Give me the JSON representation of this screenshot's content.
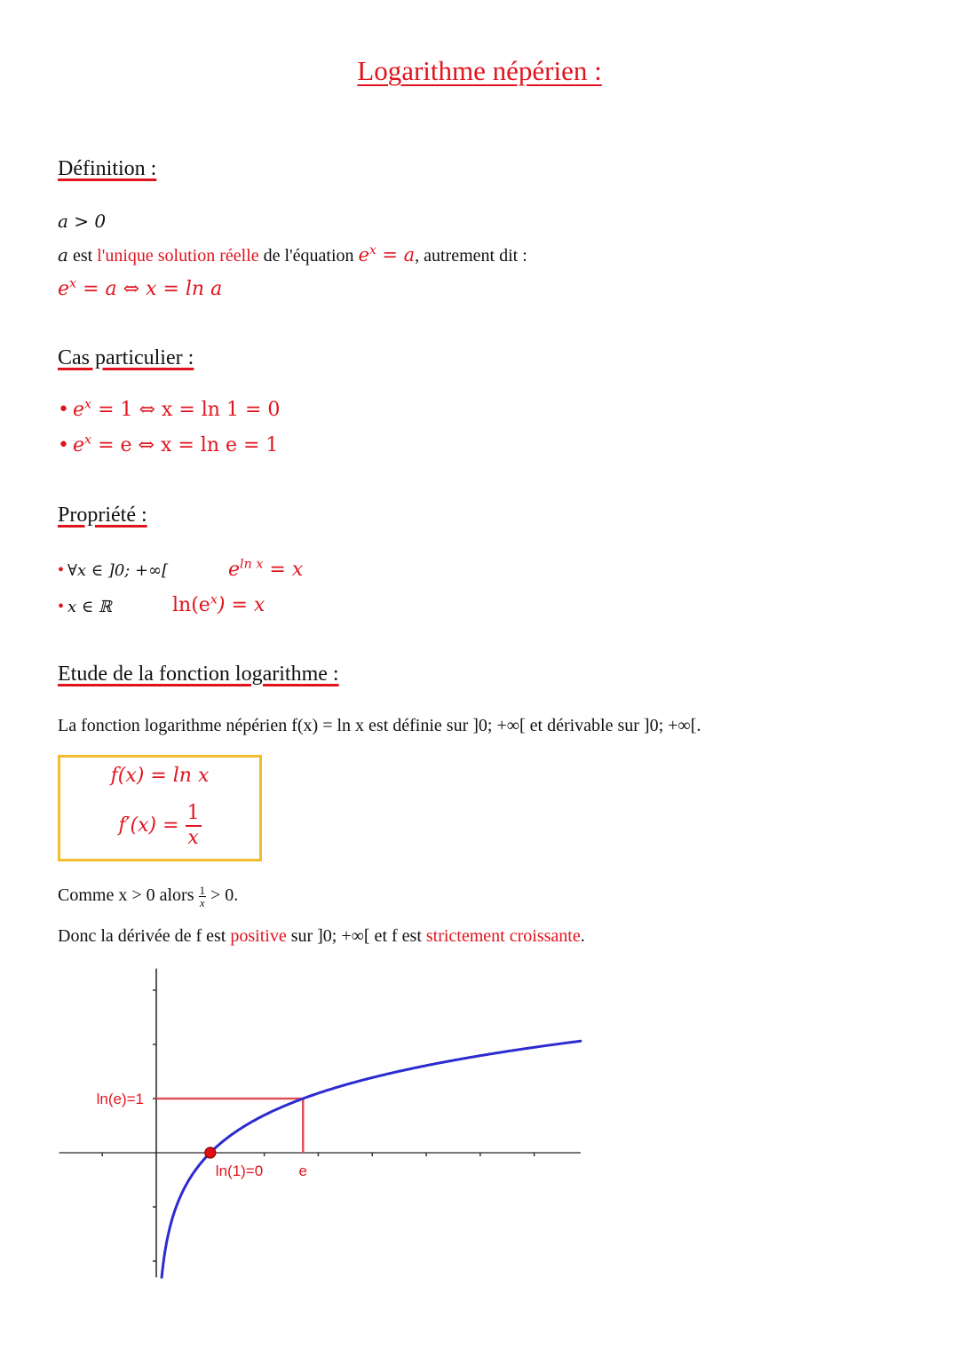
{
  "title": "Logarithme népérien :",
  "definition": {
    "heading": "Définition :",
    "condition": "a > 0",
    "line2_a": "a",
    "line2_est": " est ",
    "line2_red": "l'unique solution réelle",
    "line2_mid": " de l'équation ",
    "line2_eq_base": "e",
    "line2_eq_exp": "x",
    "line2_eq_rest": " = a",
    "line2_end": ", autrement dit :",
    "equiv_base": "e",
    "equiv_exp": "x",
    "equiv_rest": " = a ⇔ x = ln a"
  },
  "cas_particulier": {
    "heading": "Cas particulier :",
    "items": [
      {
        "bullet": "•",
        "base": "e",
        "exp": "x",
        "rest": " = 1 ⇔ x = ln 1 = 0"
      },
      {
        "bullet": "•",
        "base": "e",
        "exp": "x",
        "rest": " = e ⇔ x = ln e = 1"
      }
    ]
  },
  "propriete": {
    "heading": "Propriété :",
    "items": [
      {
        "bullet": "•",
        "domain": "∀x ∈  ]0; +∞[",
        "base": "e",
        "exp": "ln x",
        "rest": " = x"
      },
      {
        "bullet": "•",
        "domain": "x ∈ ℝ",
        "prefix": "ln(e",
        "exp": "x",
        "rest": ") = x"
      }
    ]
  },
  "etude": {
    "heading": "Etude de la fonction logarithme :",
    "intro": "La fonction logarithme népérien f(x) = ln x est définie sur ]0; +∞[ et dérivable sur ]0; +∞[.",
    "box": {
      "f": "f(x) = ln x",
      "fprime_lhs": "f′(x) = ",
      "fprime_num": "1",
      "fprime_den": "x"
    },
    "comme_a": "Comme x > 0 alors ",
    "comme_num": "1",
    "comme_den": "x",
    "comme_b": " > 0.",
    "donc_a": "Donc la dérivée de f est ",
    "donc_red1": "positive",
    "donc_b": " sur ]0; +∞[ et f est ",
    "donc_red2": "strictement croissante",
    "donc_c": "."
  },
  "colors": {
    "accent_red": "#e0141e",
    "box_border": "#f2bd2a",
    "curve_blue": "#2b2bd0",
    "guide_red": "#e0505a"
  },
  "chart_data": {
    "type": "line",
    "title": "",
    "xlabel": "",
    "ylabel": "",
    "function": "ln(x)",
    "xlim": [
      -1.8,
      7.86
    ],
    "ylim": [
      -2.3,
      3.4
    ],
    "x_ticks": [
      -1,
      1,
      2,
      3,
      4,
      5,
      6,
      7
    ],
    "y_ticks": [
      -2,
      -1,
      1,
      2,
      3
    ],
    "series": [
      {
        "name": "ln(x)",
        "x": [
          0.1,
          0.2,
          0.3,
          0.5,
          0.75,
          1,
          1.5,
          2,
          2.718,
          3,
          4,
          5,
          6,
          7,
          7.86
        ],
        "y": [
          -2.303,
          -1.609,
          -1.204,
          -0.693,
          -0.288,
          0,
          0.405,
          0.693,
          1,
          1.099,
          1.386,
          1.609,
          1.792,
          1.946,
          2.062
        ]
      }
    ],
    "points": [
      {
        "x": 1,
        "y": 0,
        "label": "ln(1)=0"
      }
    ],
    "annotations": [
      {
        "type": "hline-segment",
        "y": 1,
        "from_x": 0,
        "to_x": 2.718,
        "label": "ln(e)=1"
      },
      {
        "type": "vline-segment",
        "x": 2.718,
        "from_y": 0,
        "to_y": 1,
        "label": "e"
      }
    ],
    "grid": false
  }
}
